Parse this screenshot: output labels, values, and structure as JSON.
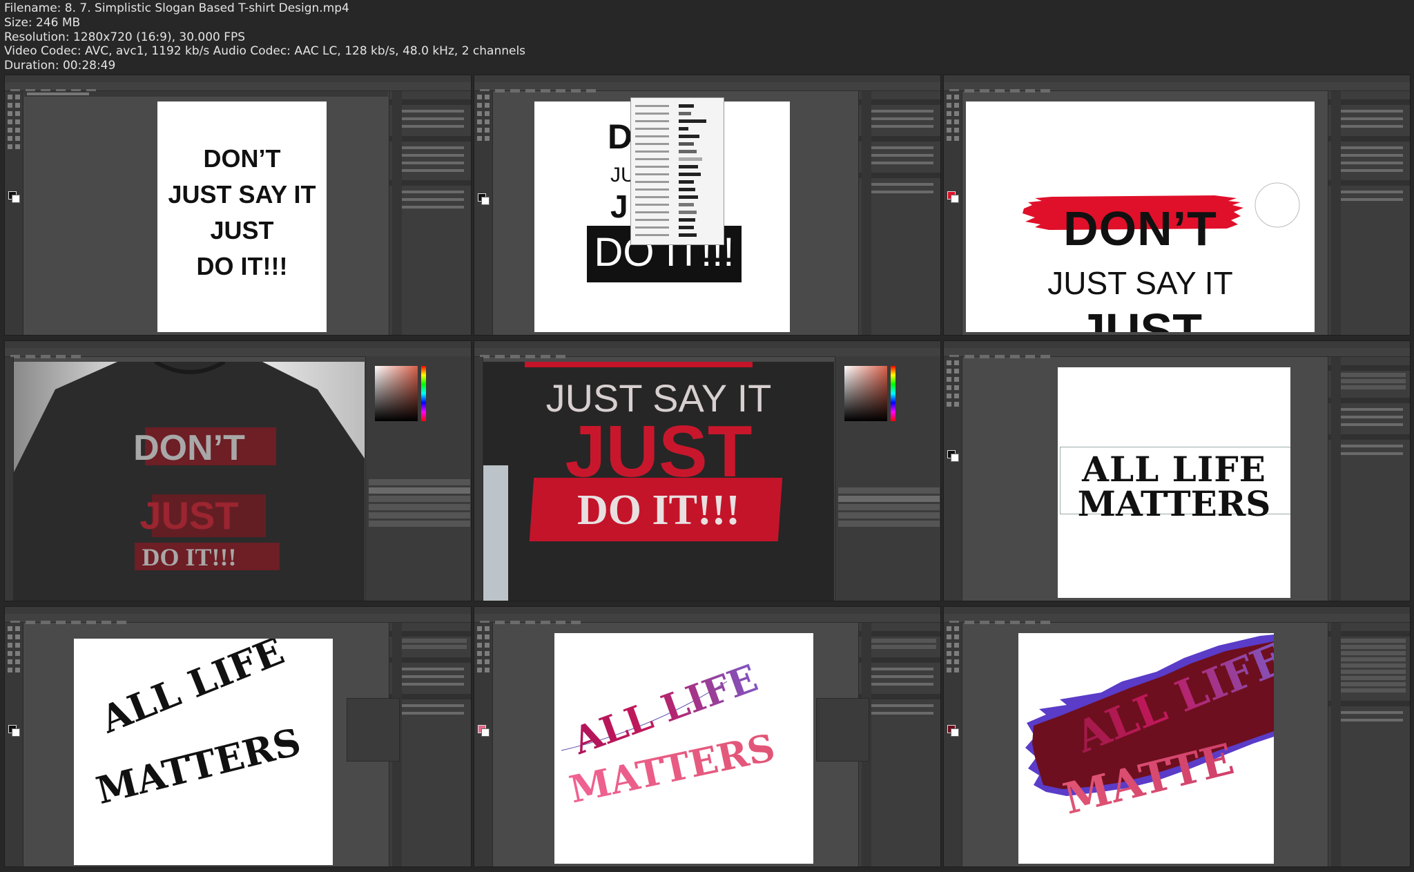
{
  "video_info": {
    "filename": "Filename: 8. 7. Simplistic Slogan Based T-shirt Design.mp4",
    "size": "Size: 246 MB",
    "resolution": "Resolution: 1280x720 (16:9), 30.000 FPS",
    "codecs": "Video Codec: AVC, avc1, 1192 kb/s Audio Codec: AAC LC, 128 kb/s, 48.0 kHz, 2 channels",
    "duration": "Duration: 00:28:49"
  },
  "frames": [
    {
      "app": "illustrator",
      "lines": [
        "DON’T",
        "JUST SAY IT",
        "JUST",
        "DO IT!!!"
      ]
    },
    {
      "app": "illustrator",
      "lines": [
        "D",
        "JU",
        "J",
        "DO IT!!!"
      ]
    },
    {
      "app": "illustrator",
      "lines": [
        "DON’T",
        "JUST SAY IT",
        "JUST"
      ],
      "brush_color": "#e0102a"
    },
    {
      "app": "photoshop",
      "lines": [
        "DON’T",
        "JUST",
        "DO IT!!!"
      ],
      "shirt_color": "#2b2b2b"
    },
    {
      "app": "photoshop",
      "lines": [
        "JUST SAY IT",
        "JUST",
        "DO IT!!!"
      ],
      "accent": "#d4122a"
    },
    {
      "app": "illustrator",
      "lines": [
        "ALL LIFE",
        "MATTERS"
      ]
    },
    {
      "app": "illustrator",
      "lines": [
        "ALL LIFE",
        "MATTERS"
      ]
    },
    {
      "app": "illustrator",
      "lines": [
        "ALL LIFE",
        "MATTERS"
      ],
      "gradient": [
        "#c2185b",
        "#7e57c2",
        "#f06292"
      ]
    },
    {
      "app": "illustrator",
      "lines": [
        "ALL LIFE",
        "MATTE"
      ],
      "background": "#6d0f1e",
      "edge": "#5a3cc8"
    }
  ],
  "icons": [
    "toolbar-icons",
    "swatch-icons"
  ],
  "colors": {
    "ui_dark": "#272727",
    "ui_panel": "#4a4a4a",
    "red": "#e0102a",
    "purple": "#7e57c2",
    "pink": "#e91e63"
  }
}
